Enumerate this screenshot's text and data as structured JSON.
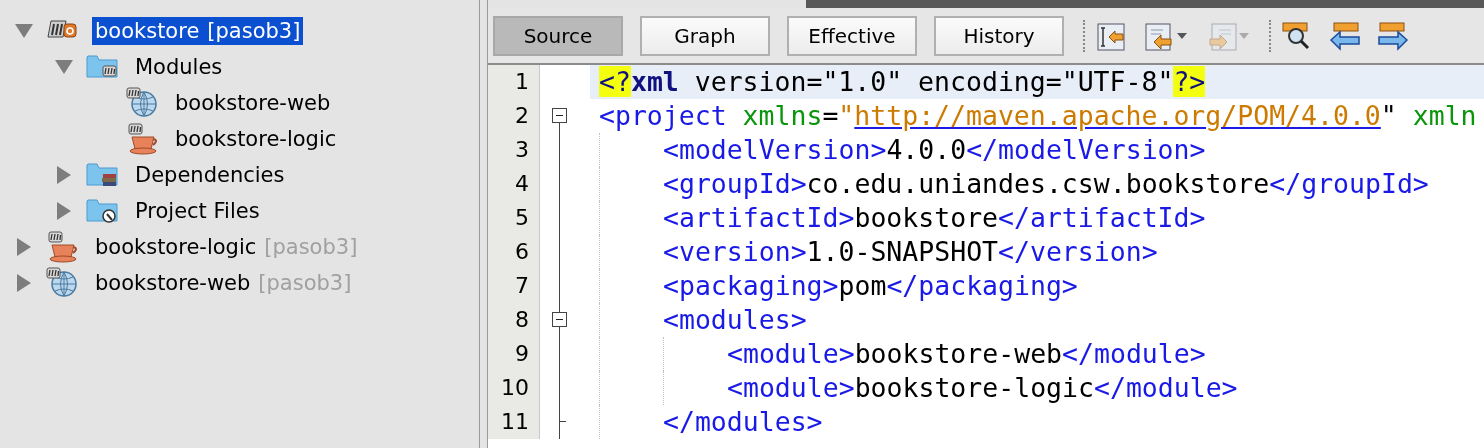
{
  "tree": [
    {
      "label": "bookstore",
      "suffix": "[pasob3]",
      "kind": "maven-project",
      "expanded": true,
      "selected": true,
      "children": [
        {
          "label": "Modules",
          "kind": "modules-folder",
          "expanded": true,
          "selected": false,
          "children": [
            {
              "label": "bookstore-web",
              "kind": "web-module",
              "selected": false
            },
            {
              "label": "bookstore-logic",
              "kind": "java-module",
              "selected": false
            }
          ]
        },
        {
          "label": "Dependencies",
          "kind": "dependencies-folder",
          "expanded": false,
          "selected": false
        },
        {
          "label": "Project Files",
          "kind": "files-folder",
          "expanded": false,
          "selected": false
        }
      ]
    },
    {
      "label": "bookstore-logic",
      "suffix": "[pasob3]",
      "kind": "java-module",
      "expanded": false,
      "selected": false
    },
    {
      "label": "bookstore-web",
      "suffix": "[pasob3]",
      "kind": "web-module",
      "expanded": false,
      "selected": false
    }
  ],
  "editor": {
    "view_tabs": [
      {
        "label": "Source",
        "selected": true
      },
      {
        "label": "Graph",
        "selected": false
      },
      {
        "label": "Effective",
        "selected": false
      },
      {
        "label": "History",
        "selected": false
      }
    ],
    "toolbar": [
      {
        "kind": "separator"
      },
      {
        "kind": "last-edit",
        "dropdown": false,
        "disabled": false
      },
      {
        "kind": "back",
        "dropdown": true,
        "disabled": false
      },
      {
        "kind": "forward",
        "dropdown": true,
        "disabled": true
      },
      {
        "kind": "separator"
      },
      {
        "kind": "find",
        "dropdown": false,
        "disabled": false
      },
      {
        "kind": "prev",
        "dropdown": false,
        "disabled": false
      },
      {
        "kind": "next",
        "dropdown": false,
        "disabled": false
      }
    ],
    "lines": [
      {
        "number": "1",
        "kind": "line",
        "current": true,
        "tokens": [
          {
            "text": "<?",
            "kind": "pi"
          },
          {
            "text": "xml",
            "kind": "keyword"
          },
          {
            "text": " version=\"1.0\" encoding=\"UTF-8\"",
            "kind": "plain"
          },
          {
            "text": "?>",
            "kind": "pi"
          }
        ]
      },
      {
        "number": "2",
        "kind": "fold-start",
        "expanded": true,
        "current": false,
        "tokens": [
          {
            "text": "<project",
            "kind": "tag"
          },
          {
            "text": " xmlns",
            "kind": "attr"
          },
          {
            "text": "=",
            "kind": "plain"
          },
          {
            "text": "\"",
            "kind": "value"
          },
          {
            "text": "http://maven.apache.org/POM/4.0.0",
            "kind": "link"
          },
          {
            "text": "\"",
            "kind": "plain"
          },
          {
            "text": " xmln",
            "kind": "attr"
          }
        ],
        "children": [
          {
            "number": "3",
            "kind": "line",
            "current": false,
            "tokens": [
              {
                "text": "<modelVersion>",
                "kind": "tag"
              },
              {
                "text": "4.0.0",
                "kind": "plain"
              },
              {
                "text": "</modelVersion>",
                "kind": "tag"
              }
            ]
          },
          {
            "number": "4",
            "kind": "line",
            "current": false,
            "tokens": [
              {
                "text": "<groupId>",
                "kind": "tag"
              },
              {
                "text": "co.edu.uniandes.csw.bookstore",
                "kind": "plain"
              },
              {
                "text": "</groupId>",
                "kind": "tag"
              }
            ]
          },
          {
            "number": "5",
            "kind": "line",
            "current": false,
            "tokens": [
              {
                "text": "<artifactId>",
                "kind": "tag"
              },
              {
                "text": "bookstore",
                "kind": "plain"
              },
              {
                "text": "</artifactId>",
                "kind": "tag"
              }
            ]
          },
          {
            "number": "6",
            "kind": "line",
            "current": false,
            "tokens": [
              {
                "text": "<version>",
                "kind": "tag"
              },
              {
                "text": "1.0-SNAPSHOT",
                "kind": "plain"
              },
              {
                "text": "</version>",
                "kind": "tag"
              }
            ]
          },
          {
            "number": "7",
            "kind": "line",
            "current": false,
            "tokens": [
              {
                "text": "<packaging>",
                "kind": "tag"
              },
              {
                "text": "pom",
                "kind": "plain"
              },
              {
                "text": "</packaging>",
                "kind": "tag"
              }
            ]
          },
          {
            "number": "8",
            "kind": "fold-start",
            "expanded": true,
            "current": false,
            "tokens": [
              {
                "text": "<modules>",
                "kind": "tag"
              }
            ],
            "children": [
              {
                "number": "9",
                "kind": "line",
                "current": false,
                "tokens": [
                  {
                    "text": "<module>",
                    "kind": "tag"
                  },
                  {
                    "text": "bookstore-web",
                    "kind": "plain"
                  },
                  {
                    "text": "</module>",
                    "kind": "tag"
                  }
                ]
              },
              {
                "number": "10",
                "kind": "line",
                "current": false,
                "tokens": [
                  {
                    "text": "<module>",
                    "kind": "tag"
                  },
                  {
                    "text": "bookstore-logic",
                    "kind": "plain"
                  },
                  {
                    "text": "</module>",
                    "kind": "tag"
                  }
                ]
              }
            ]
          },
          {
            "number": "11",
            "kind": "fold-end",
            "current": false,
            "tokens": [
              {
                "text": "</modules>",
                "kind": "tag"
              }
            ]
          }
        ]
      }
    ]
  }
}
